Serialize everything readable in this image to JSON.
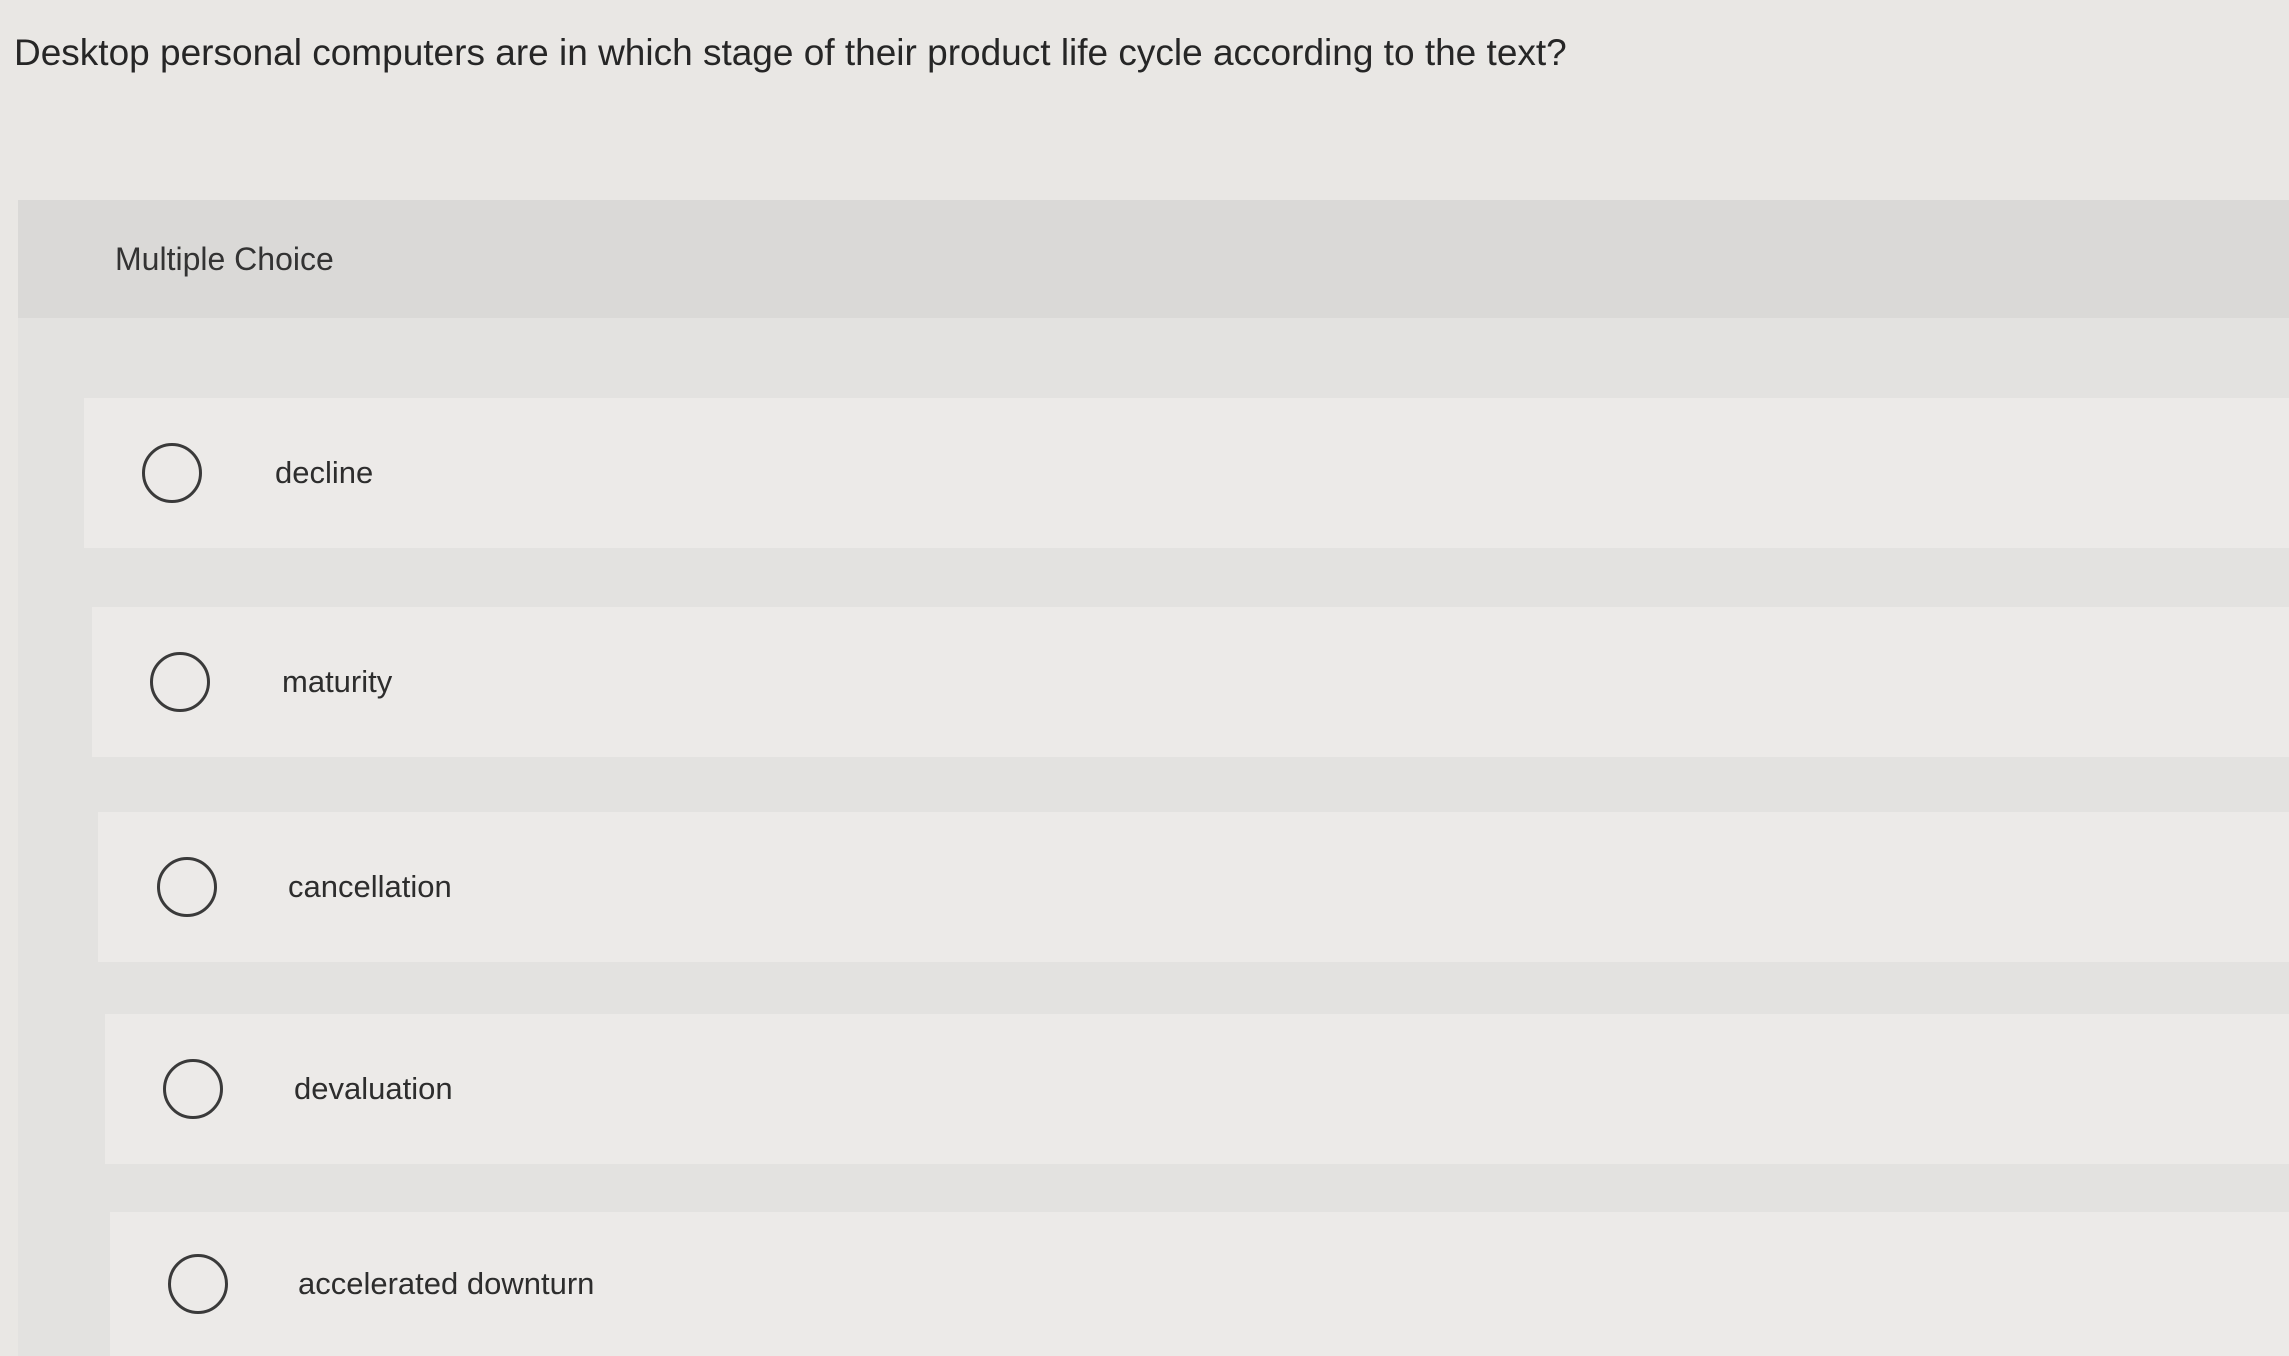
{
  "question": {
    "text": "Desktop personal computers are in which stage of their product life cycle according to the text?"
  },
  "panel": {
    "title": "Multiple Choice"
  },
  "options": [
    {
      "label": "decline"
    },
    {
      "label": "maturity"
    },
    {
      "label": "cancellation"
    },
    {
      "label": "devaluation"
    },
    {
      "label": "accelerated downturn"
    }
  ]
}
